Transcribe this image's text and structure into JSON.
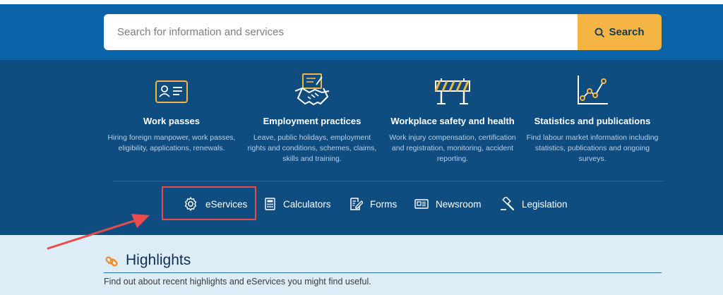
{
  "search": {
    "placeholder": "Search for information and services",
    "button_label": "Search"
  },
  "categories": [
    {
      "title": "Work passes",
      "description": "Hiring foreign manpower, work passes, eligibility, applications, renewals.",
      "icon": "id-card-icon"
    },
    {
      "title": "Employment practices",
      "description": "Leave, public holidays, employment rights and conditions, schemes, claims, skills and training.",
      "icon": "handshake-icon"
    },
    {
      "title": "Workplace safety and health",
      "description": "Work injury compensation, certification and registration, monitoring, accident reporting.",
      "icon": "barricade-icon"
    },
    {
      "title": "Statistics and publications",
      "description": "Find labour market information including statistics, publications and ongoing surveys.",
      "icon": "line-chart-icon"
    }
  ],
  "quick_links": [
    {
      "label": "eServices",
      "icon": "gear-icon"
    },
    {
      "label": "Calculators",
      "icon": "calculator-icon"
    },
    {
      "label": "Forms",
      "icon": "form-edit-icon"
    },
    {
      "label": "Newsroom",
      "icon": "newspaper-icon"
    },
    {
      "label": "Legislation",
      "icon": "gavel-icon"
    }
  ],
  "highlights": {
    "title": "Highlights",
    "subtitle": "Find out about recent highlights and eServices you might find useful.",
    "icon": "link-icon"
  },
  "colors": {
    "search_band": "#0b64a8",
    "nav_band": "#0f4c80",
    "accent": "#f5b544",
    "page_bg": "#ddedf8",
    "annotation": "#e94a4a"
  }
}
